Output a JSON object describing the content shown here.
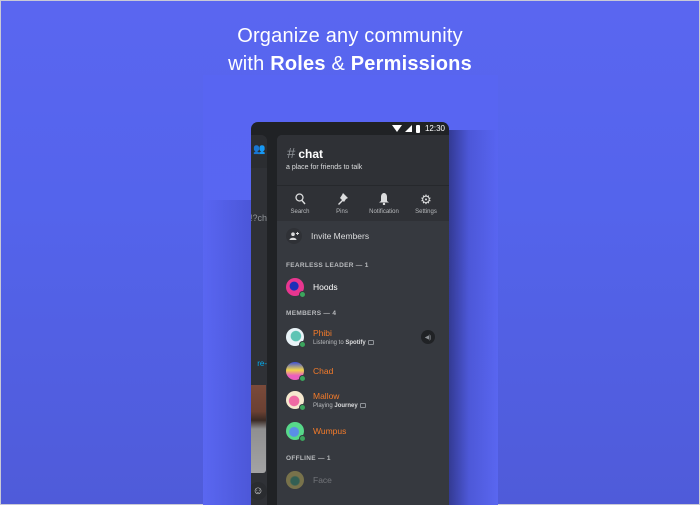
{
  "headline": {
    "line1": "Organize any community",
    "line2_prefix": "with ",
    "line2_bold1": "Roles",
    "line2_mid": " & ",
    "line2_bold2": "Permissions"
  },
  "status_bar": {
    "time": "12:30",
    "icons": [
      "wifi-icon",
      "signal-icon",
      "battery-icon"
    ]
  },
  "left_panel": {
    "partial_text_1": "ch?!",
    "partial_text_2": "-re",
    "icons": [
      "members-icon",
      "emoji-icon"
    ]
  },
  "channel": {
    "hash": "#",
    "name": "chat",
    "topic": "a place for friends to talk"
  },
  "toolbar": [
    {
      "label": "Search",
      "icon": "search-icon",
      "glyph": "⚲"
    },
    {
      "label": "Pins",
      "icon": "pin-icon",
      "glyph": "📌"
    },
    {
      "label": "Notification",
      "icon": "bell-icon",
      "glyph": "🔔"
    },
    {
      "label": "Settings",
      "icon": "gear-icon",
      "glyph": "⚙"
    }
  ],
  "invite": {
    "label": "Invite Members",
    "glyph": "👤+"
  },
  "sections": {
    "leader": "FEARLESS LEADER — 1",
    "members": "MEMBERS — 4",
    "offline": "OFFLINE — 1"
  },
  "leader": [
    {
      "name": "Hoods",
      "status": "online",
      "name_color": "#ffffff",
      "avatar_color": "#e8368f"
    }
  ],
  "members": [
    {
      "name": "Phibi",
      "activity_prefix": "Listening to ",
      "activity_bold": "Spotify",
      "status": "online",
      "name_color": "#f47b2a",
      "avatar_color": "#d9eef5",
      "voice": true
    },
    {
      "name": "Chad",
      "activity_prefix": "",
      "activity_bold": "",
      "status": "online",
      "name_color": "#f47b2a",
      "avatar_color": "#5865f2"
    },
    {
      "name": "Mallow",
      "activity_prefix": "Playing ",
      "activity_bold": "Journey",
      "status": "online",
      "name_color": "#f47b2a",
      "avatar_color": "#f5e6c8"
    },
    {
      "name": "Wumpus",
      "activity_prefix": "",
      "activity_bold": "",
      "status": "online",
      "name_color": "#f47b2a",
      "avatar_color": "#57f287"
    }
  ],
  "offline": [
    {
      "name": "Face",
      "status": "offline",
      "name_color": "#5d6067",
      "avatar_color": "#a89a4a"
    }
  ]
}
